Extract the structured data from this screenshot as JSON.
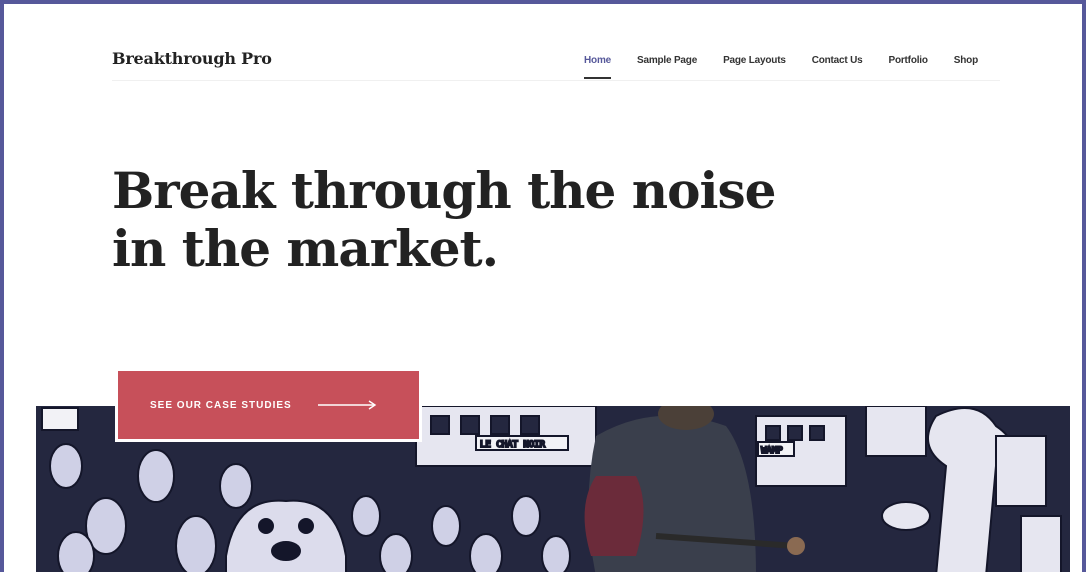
{
  "site": {
    "brand": "Breakthrough Pro"
  },
  "nav": {
    "items": [
      {
        "label": "Home",
        "active": true
      },
      {
        "label": "Sample Page"
      },
      {
        "label": "Page Layouts"
      },
      {
        "label": "Contact Us"
      },
      {
        "label": "Portfolio"
      },
      {
        "label": "Shop"
      }
    ]
  },
  "hero": {
    "title_line1": "Break through the noise",
    "title_line2": "in the market.",
    "cta_label": "SEE OUR CASE STUDIES",
    "cta_icon": "arrow-right-icon"
  },
  "banner": {
    "sign_1": "LE CHAT NOIR",
    "sign_2": "WAMP"
  },
  "colors": {
    "frame": "#56589a",
    "accent": "#c7505a",
    "text": "#222222",
    "mural_dark": "#24273f",
    "mural_light": "#cfd0e6"
  }
}
